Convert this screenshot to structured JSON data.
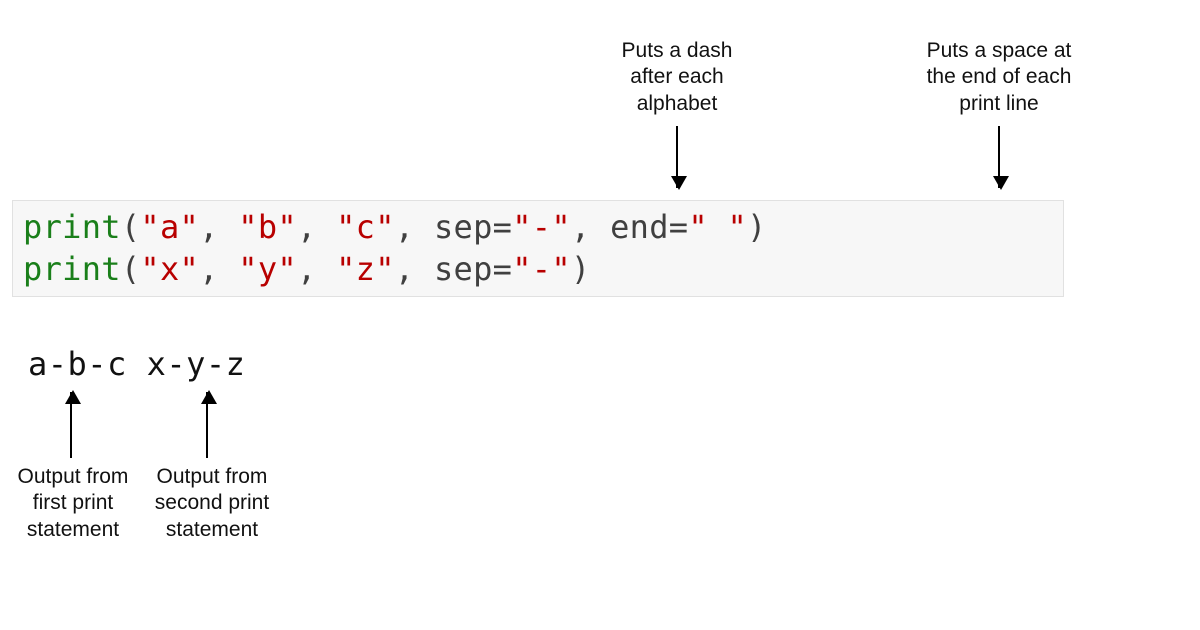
{
  "annotations": {
    "sep": "Puts a dash\nafter each\nalphabet",
    "end": "Puts a space at\nthe end of each\nprint line",
    "out_first": "Output from\nfirst print\nstatement",
    "out_second": "Output from\nsecond print\nstatement"
  },
  "code": {
    "comma_space": ", ",
    "eq": "=",
    "line1": {
      "print": "print",
      "open": "(",
      "a": "\"a\"",
      "b": "\"b\"",
      "c": "\"c\"",
      "sep_kw": "sep",
      "sep_val": "\"-\"",
      "end_kw": "end",
      "end_val": "\" \"",
      "close": ")"
    },
    "line2": {
      "print": "print",
      "open": "(",
      "x": "\"x\"",
      "y": "\"y\"",
      "z": "\"z\"",
      "sep_kw": "sep",
      "sep_val": "\"-\"",
      "close": ")"
    }
  },
  "output": {
    "text": "a-b-c x-y-z"
  }
}
